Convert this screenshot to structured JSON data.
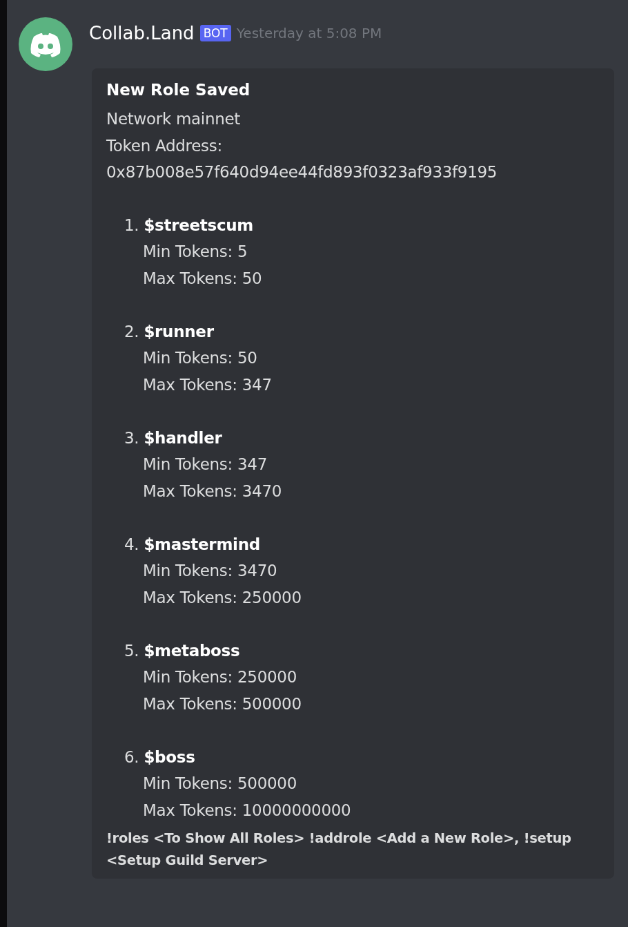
{
  "message": {
    "author": "Collab.Land",
    "badge": "BOT",
    "timestamp": "Yesterday at 5:08 PM"
  },
  "embed": {
    "title": "New Role Saved",
    "lines": [
      "Network mainnet",
      "Token Address:",
      "0x87b008e57f640d94ee44fd893f0323af933f9195"
    ],
    "roles": [
      {
        "number": "1.",
        "name": "$streetscum",
        "min": "Min Tokens: 5",
        "max": "Max Tokens: 50"
      },
      {
        "number": "2.",
        "name": "$runner",
        "min": "Min Tokens: 50",
        "max": "Max Tokens: 347"
      },
      {
        "number": "3.",
        "name": "$handler",
        "min": "Min Tokens: 347",
        "max": "Max Tokens: 3470"
      },
      {
        "number": "4.",
        "name": "$mastermind",
        "min": "Min Tokens: 3470",
        "max": "Max Tokens: 250000"
      },
      {
        "number": "5.",
        "name": "$metaboss",
        "min": "Min Tokens: 250000",
        "max": "Max Tokens: 500000"
      },
      {
        "number": "6.",
        "name": "$boss",
        "min": "Min Tokens: 500000",
        "max": "Max Tokens: 10000000000"
      }
    ],
    "footer": "!roles <To Show All Roles> !addrole <Add a New Role>, !setup <Setup Guild Server>"
  }
}
